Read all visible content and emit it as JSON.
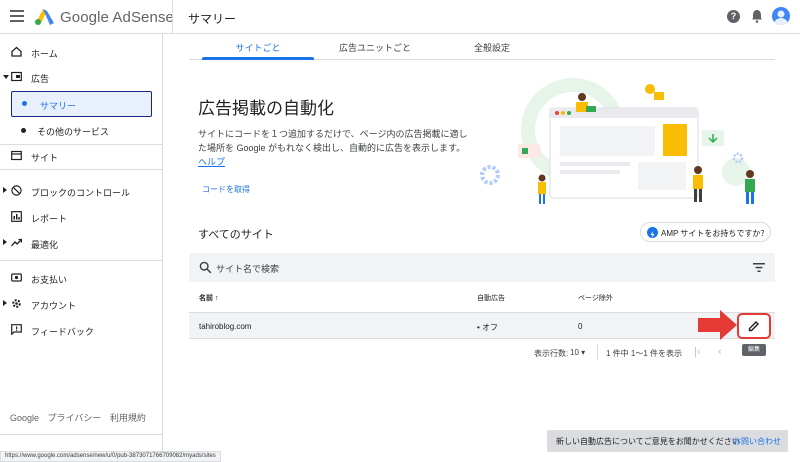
{
  "header": {
    "brand": "Google AdSense",
    "page_title": "サマリー",
    "help_glyph": "?"
  },
  "sidebar": {
    "items": [
      {
        "label": "ホーム",
        "icon": "home-icon"
      },
      {
        "label": "広告",
        "icon": "ads-icon"
      },
      {
        "label": "サマリー",
        "icon": "dot-icon"
      },
      {
        "label": "その他のサービス",
        "icon": "dot-icon"
      },
      {
        "label": "サイト",
        "icon": "sites-icon"
      },
      {
        "label": "ブロックのコントロール",
        "icon": "block-icon"
      },
      {
        "label": "レポート",
        "icon": "report-icon"
      },
      {
        "label": "最適化",
        "icon": "optimize-icon"
      },
      {
        "label": "お支払い",
        "icon": "payments-icon"
      },
      {
        "label": "アカウント",
        "icon": "gear-icon"
      },
      {
        "label": "フィードバック",
        "icon": "feedback-icon"
      }
    ],
    "footer": [
      "Google",
      "プライバシー",
      "利用規約"
    ]
  },
  "tabs": [
    "サイトごと",
    "広告ユニットごと",
    "全般設定"
  ],
  "hero": {
    "title": "広告掲載の自動化",
    "desc": "サイトにコードを１つ追加するだけで、ページ内の広告掲載に適した場所を Google がもれなく検出し、自動的に広告を表示します。",
    "help_link": "ヘルプ",
    "cta": "コードを取得"
  },
  "sites": {
    "title": "すべてのサイト",
    "amp_chip": "AMP サイトをお持ちですか？",
    "search_placeholder": "サイト名で検索",
    "columns": [
      "名前",
      "自動広告",
      "ページ除外"
    ],
    "sort_glyph": "↑",
    "rows": [
      {
        "name": "tahiroblog.com",
        "auto_ads": "• オフ",
        "excluded": "0"
      }
    ],
    "edit_tooltip": "編集"
  },
  "pager": {
    "rows_label": "表示行数:",
    "rows_value": "10",
    "range": "1 件中 1〜1 件を表示",
    "first": "|‹",
    "prev": "‹",
    "next": "›",
    "last": "›|"
  },
  "feedback": {
    "text": "新しい自動広告についてご意見をお聞かせください",
    "link": "お問い合わせ"
  },
  "status_url": "https://www.google.com/adsense/new/u/0/pub-3873071766709082/myads/sites",
  "colors": {
    "accent": "#1a73e8",
    "highlight": "#e53935",
    "panel": "#f1f3f4"
  }
}
